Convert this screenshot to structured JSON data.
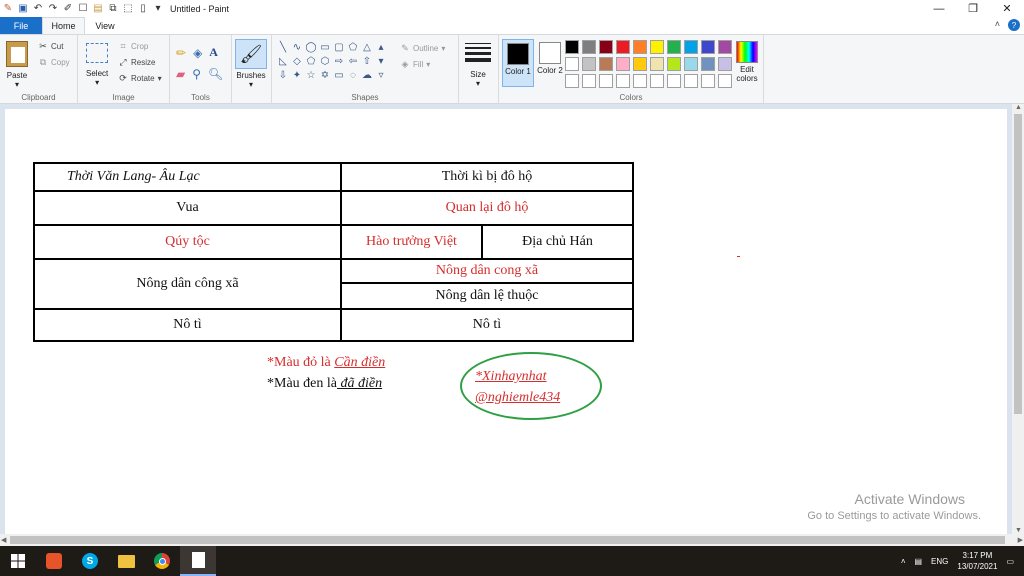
{
  "window": {
    "title": "Untitled - Paint",
    "minimize_glyph": "—",
    "restore_glyph": "❐",
    "close_glyph": "✕"
  },
  "tabs": {
    "file": "File",
    "home": "Home",
    "view": "View"
  },
  "ribbon": {
    "clipboard": {
      "paste": "Paste",
      "cut": "Cut",
      "copy": "Copy",
      "label": "Clipboard"
    },
    "image": {
      "select": "Select",
      "crop": "Crop",
      "resize": "Resize",
      "rotate": "Rotate",
      "label": "Image"
    },
    "tools": {
      "label": "Tools"
    },
    "brushes": {
      "label": "Brushes"
    },
    "shapes": {
      "outline": "Outline",
      "fill": "Fill",
      "label": "Shapes"
    },
    "size": {
      "label": "Size"
    },
    "colors": {
      "color1": "Color 1",
      "color2": "Color 2",
      "edit": "Edit colors",
      "label": "Colors",
      "color1_value": "#000000",
      "color2_value": "#ffffff",
      "palette": [
        "#000000",
        "#7f7f7f",
        "#880015",
        "#ed1c24",
        "#ff7f27",
        "#fff200",
        "#22b14c",
        "#00a2e8",
        "#3f48cc",
        "#a349a4",
        "#ffffff",
        "#c3c3c3",
        "#b97a57",
        "#ffaec9",
        "#ffc90e",
        "#efe4b0",
        "#b5e61d",
        "#99d9ea",
        "#7092be",
        "#c8bfe7"
      ]
    }
  },
  "canvas": {
    "table": {
      "r1c1": "Thời Văn Lang- Âu Lạc",
      "r1c2": "Thời kì bị đô hộ",
      "r2c1": "Vua",
      "r2c2": "Quan lại đô hộ",
      "r3c1": "Qúy tộc",
      "r3c2": "Hào trưởng Việt",
      "r3c3": "Địa chủ Hán",
      "r4c1": "Nông dân công xã",
      "r4c2": "Nông dân cong xã",
      "r5c2": "Nông dân lệ thuộc",
      "r6c1": "Nô tì",
      "r6c2": "Nô tì"
    },
    "note_red_prefix": "*Màu đỏ là ",
    "note_red_em": "Cần điền",
    "note_black_prefix": "*Màu đen là",
    "note_black_em": " đã điền",
    "sig_line1": "*Xinhaynhat",
    "sig_line2": "@nghiemle434",
    "red_color": "#d62d2d",
    "oval_color": "#2ea043"
  },
  "activation": {
    "title": "Activate Windows",
    "subtitle": "Go to Settings to activate Windows."
  },
  "taskbar": {
    "lang": "ENG",
    "time": "3:17 PM",
    "date": "13/07/2021"
  }
}
